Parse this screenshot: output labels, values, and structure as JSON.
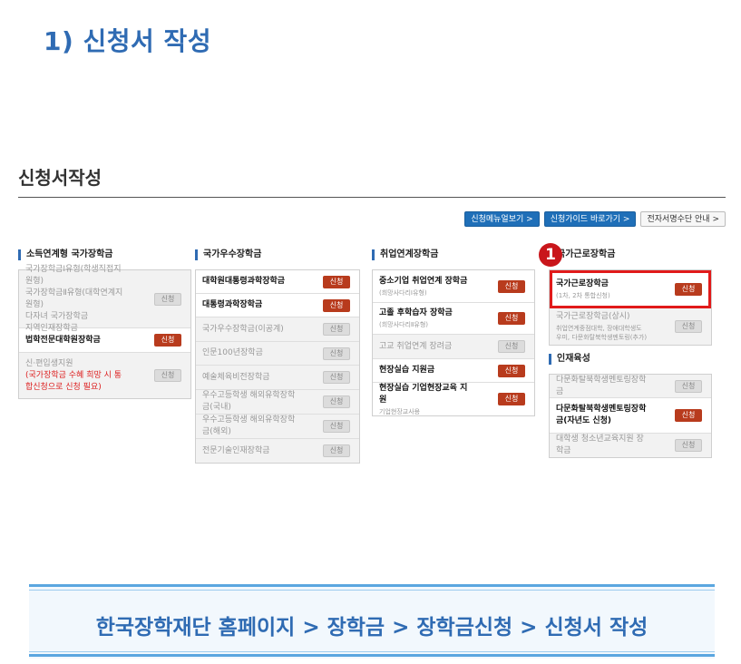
{
  "heading": "1) 신청서 작성",
  "section_title": "신청서작성",
  "top_buttons": [
    {
      "label": "신청메뉴얼보기 >"
    },
    {
      "label": "신청가이드 바로가기 >"
    },
    {
      "label": "전자서명수단 안내 >"
    }
  ],
  "callout_number": "1",
  "columns": [
    {
      "title": "소득연계형 국가장학금",
      "items": [
        {
          "lines": [
            "국가장학금Ⅰ유형(학생직접지원형)",
            "국가장학금Ⅱ유형(대학연계지원형)",
            "다자녀 국가장학금",
            "지역인재장학금"
          ],
          "button": "신청",
          "enabled": false
        },
        {
          "label": "법학전문대학원장학금",
          "button": "신청",
          "enabled": true
        },
        {
          "label": "신·편입생지원",
          "red": "(국가장학금 수혜 희망 시 통합신청으로 신청 필요)",
          "button": "신청",
          "enabled": false
        }
      ]
    },
    {
      "title": "국가우수장학금",
      "items": [
        {
          "label": "대학원대통령과학장학금",
          "button": "신청",
          "enabled": true
        },
        {
          "label": "대통령과학장학금",
          "button": "신청",
          "enabled": true
        },
        {
          "label": "국가우수장학금(이공계)",
          "button": "신청",
          "enabled": false
        },
        {
          "label": "인문100년장학금",
          "button": "신청",
          "enabled": false
        },
        {
          "label": "예술체육비전장학금",
          "button": "신청",
          "enabled": false
        },
        {
          "label": "우수고등학생 해외유학장학금(국내)",
          "button": "신청",
          "enabled": false
        },
        {
          "label": "우수고등학생 해외유학장학금(해외)",
          "button": "신청",
          "enabled": false
        },
        {
          "label": "전문기술인재장학금",
          "button": "신청",
          "enabled": false
        }
      ]
    },
    {
      "title": "취업연계장학금",
      "items": [
        {
          "label": "중소기업 취업연계 장학금",
          "sub": "(희망사다리Ⅰ유형)",
          "button": "신청",
          "enabled": true
        },
        {
          "label": "고졸 후학습자 장학금",
          "sub": "(희망사다리Ⅱ유형)",
          "button": "신청",
          "enabled": true
        },
        {
          "label": "고교 취업연계 장려금",
          "button": "신청",
          "enabled": false
        },
        {
          "label": "현장실습 지원금",
          "button": "신청",
          "enabled": true
        },
        {
          "label": "현장실습 기업현장교육 지원",
          "sub": "기업현장교사용",
          "button": "신청",
          "enabled": true
        }
      ]
    },
    {
      "title": "국가근로장학금",
      "items": [
        {
          "label": "국가근로장학금",
          "sub": "(1차, 2차 통합신청)",
          "button": "신청",
          "enabled": true,
          "highlight": true
        },
        {
          "label": "국가근로장학금(상시)",
          "sub": "취업연계중점대학, 장애대학생도우미, 다문화탈북학생멘토링(추가)",
          "button": "신청",
          "enabled": false
        }
      ]
    },
    {
      "title": "인재육성",
      "items": [
        {
          "label": "다문화탈북학생멘토링장학금",
          "button": "신청",
          "enabled": false
        },
        {
          "label": "다문화탈북학생멘토링장학금(자년도 신청)",
          "button": "신청",
          "enabled": true
        },
        {
          "label": "대학생 청소년교육지원 장학금",
          "button": "신청",
          "enabled": false
        }
      ]
    }
  ],
  "footer_path": "한국장학재단 홈페이지 > 장학금 > 장학금신청 > 신청서 작성",
  "colors": {
    "accent": "#2f6bb3",
    "apply": "#b83b1d",
    "highlight": "#e11a1a",
    "callout": "#c9161b"
  }
}
